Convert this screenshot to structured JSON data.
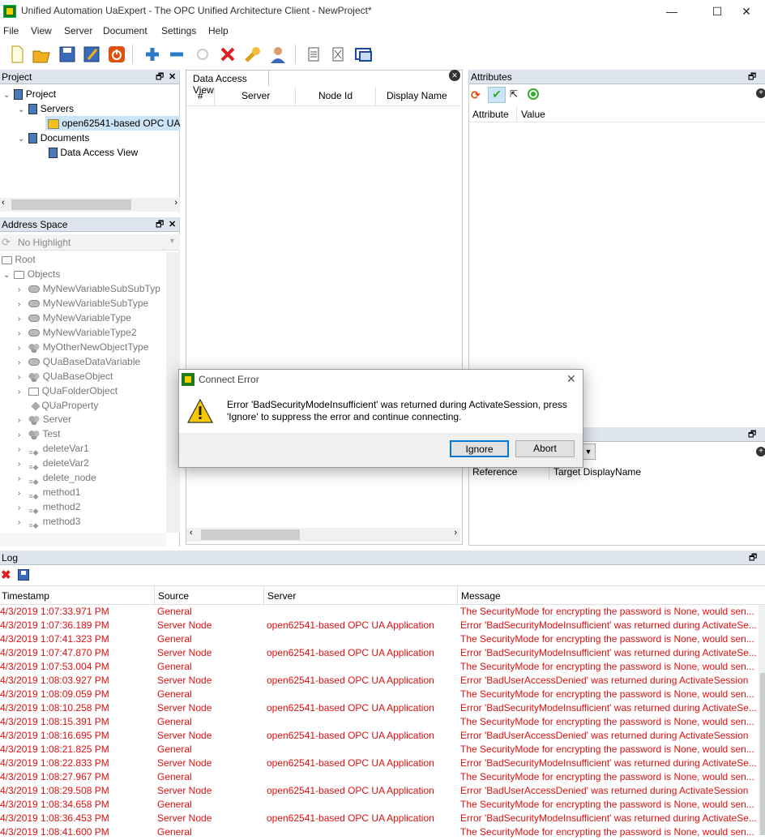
{
  "window": {
    "title": "Unified Automation UaExpert - The OPC Unified Architecture Client - NewProject*",
    "minimize": "—",
    "maximize": "☐",
    "close": "✕"
  },
  "menu": [
    "File",
    "View",
    "Server",
    "Document",
    "Settings",
    "Help"
  ],
  "project_panel": {
    "title": "Project",
    "tree": {
      "project": "Project",
      "servers": "Servers",
      "server_item": "open62541-based OPC UA",
      "documents": "Documents",
      "data_access_view": "Data Access View"
    }
  },
  "address_space": {
    "title": "Address Space",
    "highlight_placeholder": "No Highlight",
    "items": {
      "root": "Root",
      "objects": "Objects",
      "i0": "MyNewVariableSubSubTyp",
      "i1": "MyNewVariableSubType",
      "i2": "MyNewVariableType",
      "i3": "MyNewVariableType2",
      "i4": "MyOtherNewObjectType",
      "i5": "QUaBaseDataVariable",
      "i6": "QUaBaseObject",
      "i7": "QUaFolderObject",
      "i8": "QUaProperty",
      "i9": "Server",
      "i10": "Test",
      "i11": "deleteVar1",
      "i12": "deleteVar2",
      "i13": "delete_node",
      "i14": "method1",
      "i15": "method2",
      "i16": "method3"
    }
  },
  "data_access": {
    "tab": "Data Access View",
    "columns": [
      "#",
      "Server",
      "Node Id",
      "Display Name"
    ]
  },
  "attributes": {
    "title": "Attributes",
    "columns": [
      "Attribute",
      "Value"
    ]
  },
  "references": {
    "columns": [
      "Reference",
      "Target DisplayName"
    ]
  },
  "dialog": {
    "title": "Connect Error",
    "message_line1": "Error 'BadSecurityModeInsufficient' was returned during ActivateSession, press",
    "message_line2": "'Ignore' to suppress the error and continue connecting.",
    "ignore": "Ignore",
    "abort": "Abort"
  },
  "log": {
    "title": "Log",
    "columns": [
      "Timestamp",
      "Source",
      "Server",
      "Message"
    ],
    "rows": [
      {
        "ts": "4/3/2019 1:07:33.971 PM",
        "src": "General",
        "srv": "",
        "msg": "The SecurityMode for encrypting the password is None, would sen..."
      },
      {
        "ts": "4/3/2019 1:07:36.189 PM",
        "src": "Server Node",
        "srv": "open62541-based OPC UA Application",
        "msg": "Error 'BadSecurityModeInsufficient' was returned during ActivateSe..."
      },
      {
        "ts": "4/3/2019 1:07:41.323 PM",
        "src": "General",
        "srv": "",
        "msg": "The SecurityMode for encrypting the password is None, would sen..."
      },
      {
        "ts": "4/3/2019 1:07:47.870 PM",
        "src": "Server Node",
        "srv": "open62541-based OPC UA Application",
        "msg": "Error 'BadSecurityModeInsufficient' was returned during ActivateSe..."
      },
      {
        "ts": "4/3/2019 1:07:53.004 PM",
        "src": "General",
        "srv": "",
        "msg": "The SecurityMode for encrypting the password is None, would sen..."
      },
      {
        "ts": "4/3/2019 1:08:03.927 PM",
        "src": "Server Node",
        "srv": "open62541-based OPC UA Application",
        "msg": "Error 'BadUserAccessDenied' was returned during ActivateSession"
      },
      {
        "ts": "4/3/2019 1:08:09.059 PM",
        "src": "General",
        "srv": "",
        "msg": "The SecurityMode for encrypting the password is None, would sen..."
      },
      {
        "ts": "4/3/2019 1:08:10.258 PM",
        "src": "Server Node",
        "srv": "open62541-based OPC UA Application",
        "msg": "Error 'BadSecurityModeInsufficient' was returned during ActivateSe..."
      },
      {
        "ts": "4/3/2019 1:08:15.391 PM",
        "src": "General",
        "srv": "",
        "msg": "The SecurityMode for encrypting the password is None, would sen..."
      },
      {
        "ts": "4/3/2019 1:08:16.695 PM",
        "src": "Server Node",
        "srv": "open62541-based OPC UA Application",
        "msg": "Error 'BadUserAccessDenied' was returned during ActivateSession"
      },
      {
        "ts": "4/3/2019 1:08:21.825 PM",
        "src": "General",
        "srv": "",
        "msg": "The SecurityMode for encrypting the password is None, would sen..."
      },
      {
        "ts": "4/3/2019 1:08:22.833 PM",
        "src": "Server Node",
        "srv": "open62541-based OPC UA Application",
        "msg": "Error 'BadSecurityModeInsufficient' was returned during ActivateSe..."
      },
      {
        "ts": "4/3/2019 1:08:27.967 PM",
        "src": "General",
        "srv": "",
        "msg": "The SecurityMode for encrypting the password is None, would sen..."
      },
      {
        "ts": "4/3/2019 1:08:29.508 PM",
        "src": "Server Node",
        "srv": "open62541-based OPC UA Application",
        "msg": "Error 'BadUserAccessDenied' was returned during ActivateSession"
      },
      {
        "ts": "4/3/2019 1:08:34.658 PM",
        "src": "General",
        "srv": "",
        "msg": "The SecurityMode for encrypting the password is None, would sen..."
      },
      {
        "ts": "4/3/2019 1:08:36.453 PM",
        "src": "Server Node",
        "srv": "open62541-based OPC UA Application",
        "msg": "Error 'BadSecurityModeInsufficient' was returned during ActivateSe..."
      },
      {
        "ts": "4/3/2019 1:08:41.600 PM",
        "src": "General",
        "srv": "",
        "msg": "The SecurityMode for encrypting the password is None, would sen..."
      }
    ]
  },
  "colors": {
    "panel_header": "#dfe5ef",
    "log_error": "#e01010",
    "dialog_bg": "#f0f0f0"
  }
}
